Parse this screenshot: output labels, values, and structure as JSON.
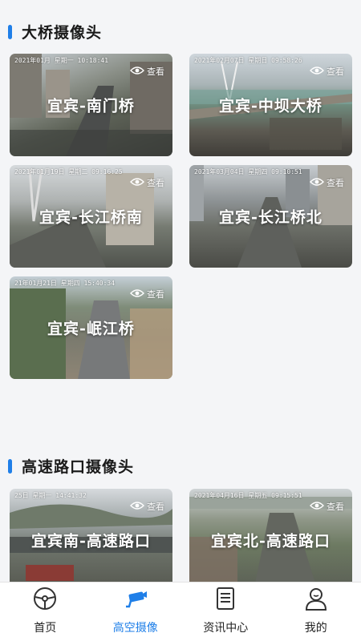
{
  "sections": [
    {
      "title": "大桥摄像头"
    },
    {
      "title": "高速路口摄像头"
    }
  ],
  "view_label": "查看",
  "cameras": [
    {
      "name": "宜宾-南门桥",
      "stamp": "2021年01月   星期一  10:18:41"
    },
    {
      "name": "宜宾-中坝大桥",
      "stamp": "2021年02月07日  星期日  09:58:26"
    },
    {
      "name": "宜宾-长江桥南",
      "stamp": "2021年01月19日  星期二  09:16:25"
    },
    {
      "name": "宜宾-长江桥北",
      "stamp": "2021年03月04日  星期四  09:10:51"
    },
    {
      "name": "宜宾-岷江桥",
      "stamp": "21年01月21日  星期四  15:40:34"
    },
    {
      "name": "宜宾南-高速路口",
      "stamp": "25日  星期一  14:41:32"
    },
    {
      "name": "宜宾北-高速路口",
      "stamp": "2021年04月16日  星期五  09:15:51"
    }
  ],
  "tabs": [
    {
      "label": "首页",
      "icon": "steering-wheel-icon",
      "active": false
    },
    {
      "label": "高空摄像",
      "icon": "camera-icon",
      "active": true
    },
    {
      "label": "资讯中心",
      "icon": "document-icon",
      "active": false
    },
    {
      "label": "我的",
      "icon": "user-icon",
      "active": false
    }
  ],
  "colors": {
    "accent": "#1f7fe8",
    "text": "#1a1a1a",
    "background": "#f4f5f7"
  }
}
